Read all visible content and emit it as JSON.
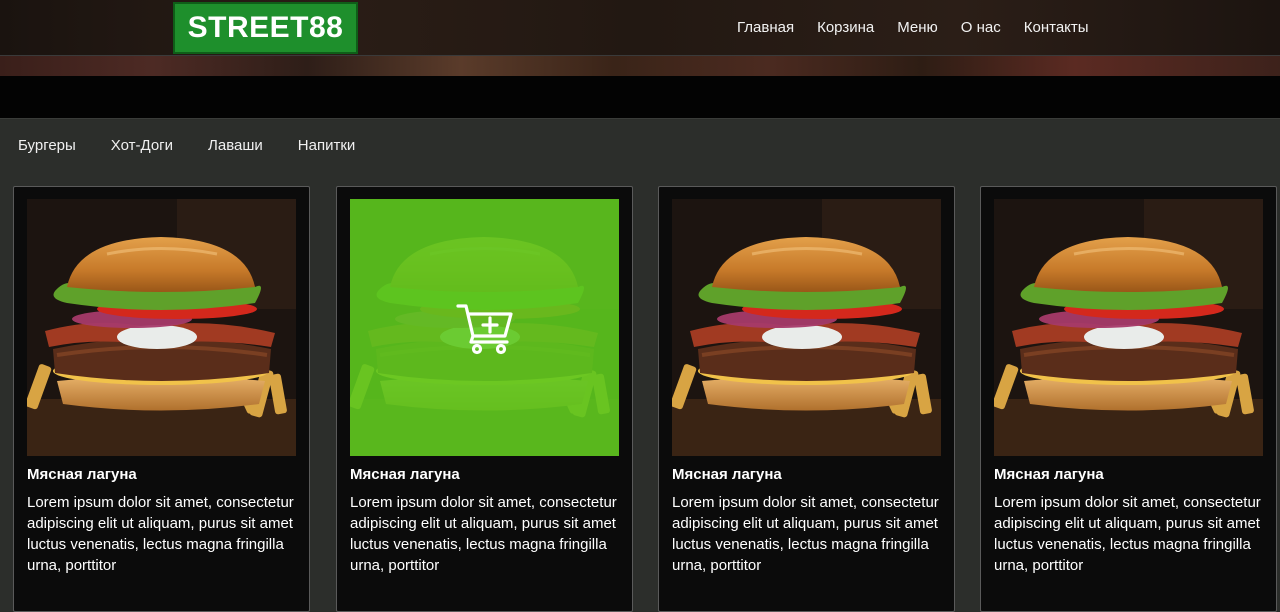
{
  "header": {
    "logo": "STREET88",
    "nav": [
      "Главная",
      "Корзина",
      "Меню",
      "О нас",
      "Контакты"
    ]
  },
  "categories": [
    "Бургеры",
    "Хот-Доги",
    "Лаваши",
    "Напитки"
  ],
  "products": [
    {
      "title": "Мясная лагуна",
      "description": "Lorem ipsum dolor sit amet, consectetur adipiscing elit ut aliquam, purus sit amet luctus venenatis, lectus magna fringilla urna, porttitor",
      "image_icon": "burger-photo",
      "hovered": false
    },
    {
      "title": "Мясная лагуна",
      "description": "Lorem ipsum dolor sit amet, consectetur adipiscing elit ut aliquam, purus sit amet luctus venenatis, lectus magna fringilla urna, porttitor",
      "image_icon": "burger-photo",
      "hovered": true,
      "overlay_icon": "add-to-cart-icon"
    },
    {
      "title": "Мясная лагуна",
      "description": "Lorem ipsum dolor sit amet, consectetur adipiscing elit ut aliquam, purus sit amet luctus venenatis, lectus magna fringilla urna, porttitor",
      "image_icon": "burger-photo",
      "hovered": false
    },
    {
      "title": "Мясная лагуна",
      "description": "Lorem ipsum dolor sit amet, consectetur adipiscing elit ut aliquam, purus sit amet luctus venenatis, lectus magna fringilla urna, porttitor",
      "image_icon": "burger-photo",
      "hovered": false
    }
  ],
  "colors": {
    "logo_bg": "#1e8f2c",
    "overlay": "#5dc81e",
    "card_bg": "#0b0b0b",
    "page_bg": "#2c2e2b"
  }
}
